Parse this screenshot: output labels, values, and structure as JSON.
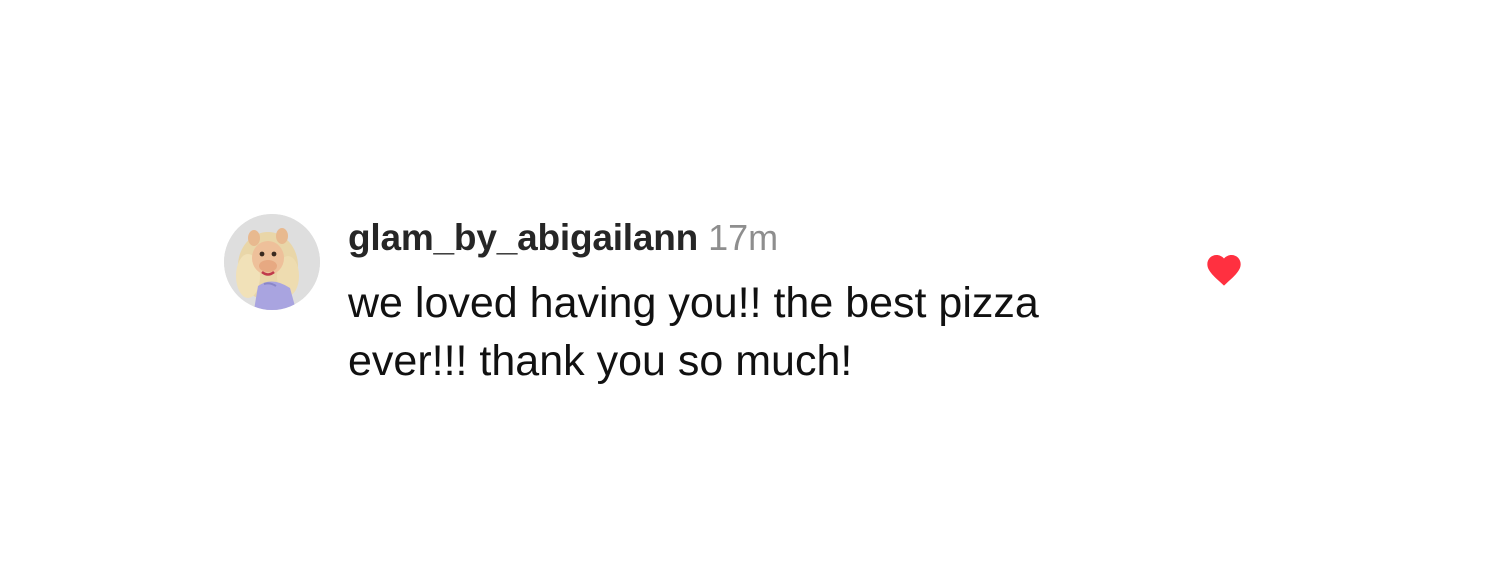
{
  "comment": {
    "avatar": {
      "icon": "user-avatar",
      "background_color": "#dcdcdc"
    },
    "username": "glam_by_abigailann",
    "timestamp": "17m",
    "text": "we loved having you!! the best pizza ever!!! thank you so much!",
    "like": {
      "icon": "heart-filled-icon",
      "liked": true,
      "color": "#ff3040"
    }
  }
}
